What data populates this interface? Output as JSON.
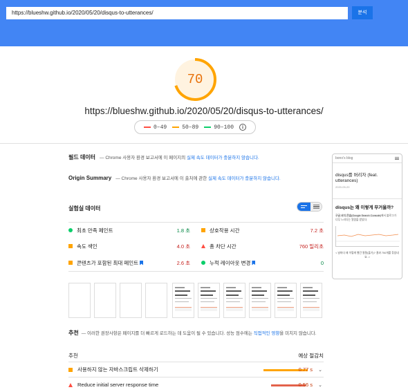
{
  "header": {
    "url_value": "https://blueshw.github.io/2020/05/20/disqus-to-utterances/",
    "analyze_label": "분석"
  },
  "gauge": {
    "score": "70",
    "score_fraction": 0.7,
    "color": "#e8710a"
  },
  "main_url": "https://blueshw.github.io/2020/05/20/disqus-to-utterances/",
  "legend": [
    {
      "range": "0–49",
      "color": "#ff4e42"
    },
    {
      "range": "50–89",
      "color": "#ffa400"
    },
    {
      "range": "90–100",
      "color": "#0cce6b"
    }
  ],
  "field_data": {
    "title": "필드 데이터",
    "text": "— Chrome 사용자 환경 보고서에 이 페이지의 ",
    "link": "실제 속도 데이터가 충분하지 않습니다."
  },
  "origin_summary": {
    "title": "Origin Summary",
    "text": "— Chrome 사용자 환경 보고서에 이 출처에 관한 ",
    "link": "실제 속도 데이터가 충분하지 않습니다."
  },
  "lab_data": {
    "title": "실험실 데이터",
    "metrics": [
      {
        "label": "최초 만족 페인트",
        "value": "1.8 초",
        "status": "good",
        "color": "#018642"
      },
      {
        "label": "상호작용 시간",
        "value": "7.2 초",
        "status": "poor",
        "color": "#c5221f"
      },
      {
        "label": "속도 색인",
        "value": "4.0 초",
        "status": "poor",
        "color": "#c5221f"
      },
      {
        "label": "총 차단 시간",
        "value": "760 밀리초",
        "status": "poor",
        "color": "#c5221f"
      },
      {
        "label": "콘텐츠가 포함된 최대 페인트",
        "value": "2.6 초",
        "status": "average",
        "color": "#c5221f"
      },
      {
        "label": "누적 레이아웃 변경",
        "value": "0",
        "status": "good",
        "color": "#018642"
      }
    ]
  },
  "recommendations": {
    "title": "추천",
    "text": "— 이러한 권장사항은 페이지를 더 빠르게 로드하는 데 도움이 될 수 있습니다. 성능 점수에는 ",
    "link": "직접적인 영향",
    "text_end": "을 미치지 않습니다.",
    "col_opportunity": "추천",
    "col_savings": "예상 절감치",
    "items": [
      {
        "label": "사용하지 않는 자바스크립트 삭제하기",
        "value": "0.77 s",
        "color": "#ffa400",
        "value_color": "#c33300",
        "bar_fraction": 0.58
      },
      {
        "label": "Reduce initial server response time",
        "value": "0.56 s",
        "color": "#e3624b",
        "value_color": "#c33300",
        "bar_fraction": 0.45
      }
    ]
  },
  "preview": {
    "site_name": "bono's blog",
    "post_title": "disqus를 버리자 (feat. utterances)",
    "post_date": "2020-05-20",
    "heading": "disqus는 왜 이렇게 무거울까?",
    "highlight": "구글 서치 콘솔(Google Search Console)",
    "text": "에서 블로그가 너무 느리다는 알람을 받았다.",
    "caption": "< 날마다 왜 이렇게 빨간 팔찰(출기)? 결과 750개를 찾았네요. >"
  }
}
